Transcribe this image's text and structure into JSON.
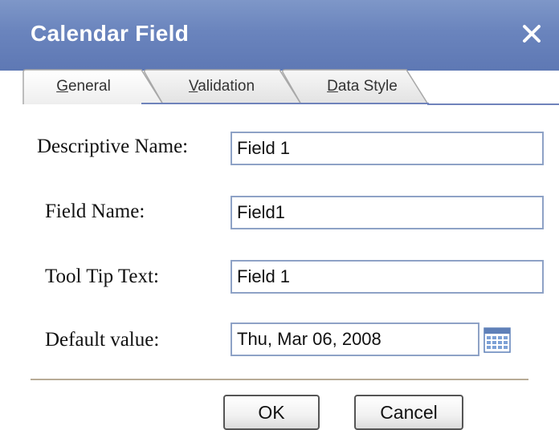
{
  "window": {
    "title": "Calendar Field"
  },
  "tabs": [
    {
      "label": "General",
      "mnemonic": "G",
      "rest": "eneral"
    },
    {
      "label": "Validation",
      "mnemonic": "V",
      "rest": "alidation"
    },
    {
      "label": "Data Style",
      "mnemonic": "D",
      "rest": "ata Style"
    }
  ],
  "form": {
    "descriptive_name": {
      "label": "Descriptive Name:",
      "value": "Field 1"
    },
    "field_name": {
      "label": "Field Name:",
      "value": "Field1"
    },
    "tool_tip_text": {
      "label": "Tool Tip Text:",
      "value": "Field 1"
    },
    "default_value": {
      "label": "Default value:",
      "value": "Thu, Mar 06, 2008"
    }
  },
  "buttons": {
    "ok": "OK",
    "cancel": "Cancel"
  },
  "icons": {
    "close": "close-icon",
    "calendar": "calendar-icon"
  },
  "colors": {
    "titlebar": "#6a84bd",
    "title_text": "#ffffff",
    "input_border": "#8ea2c6",
    "tab_line": "#6f83bb"
  }
}
